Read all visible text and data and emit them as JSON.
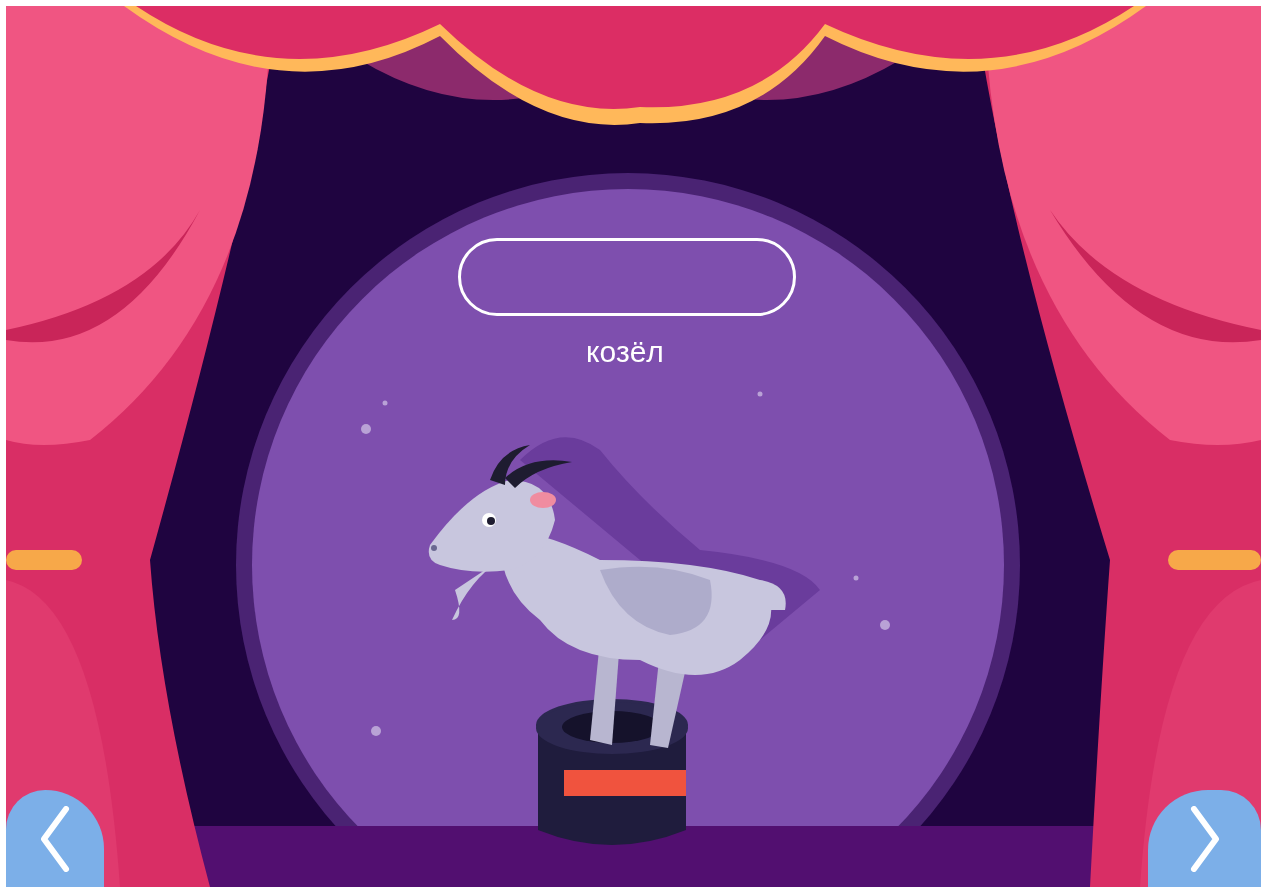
{
  "word": "козёл"
}
